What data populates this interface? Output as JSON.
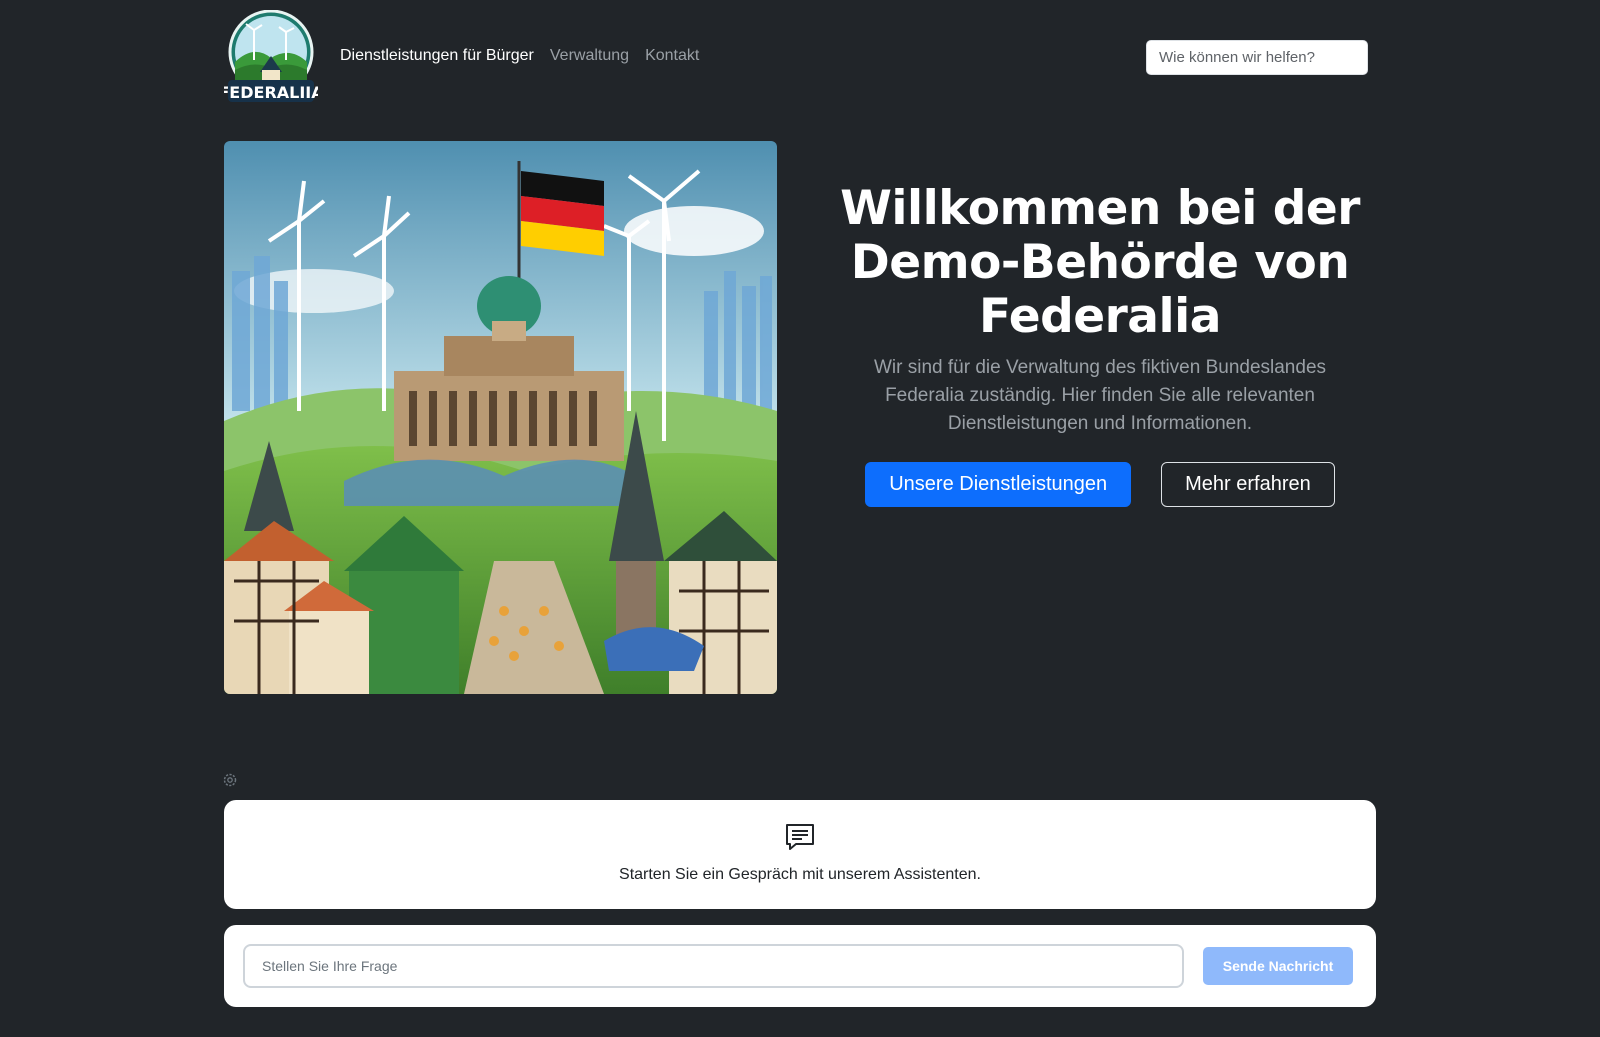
{
  "header": {
    "logo_text": "FEDERALIIA",
    "nav": [
      {
        "label": "Dienstleistungen für Bürger",
        "active": true
      },
      {
        "label": "Verwaltung",
        "active": false
      },
      {
        "label": "Kontakt",
        "active": false
      }
    ],
    "search_placeholder": "Wie können wir helfen?"
  },
  "hero": {
    "title": "Willkommen bei der Demo-Behörde von Federalia",
    "lead": "Wir sind für die Verwaltung des fiktiven Bundeslandes Federalia zuständig. Hier finden Sie alle relevanten Dienstleistungen und Informationen.",
    "primary_button": "Unsere Dienstleistungen",
    "secondary_button": "Mehr erfahren"
  },
  "chat": {
    "empty_message": "Starten Sie ein Gespräch mit unserem Assistenten.",
    "input_placeholder": "Stellen Sie Ihre Frage",
    "send_label": "Sende Nachricht"
  },
  "colors": {
    "background": "#212529",
    "primary": "#0d6efd",
    "send_disabled": "#8fb9fb"
  }
}
